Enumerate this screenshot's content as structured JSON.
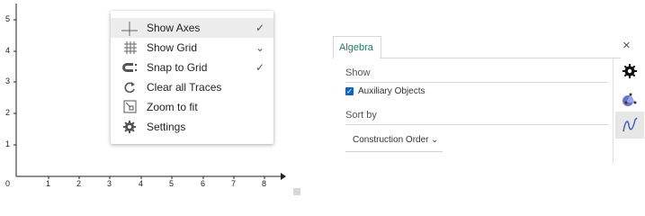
{
  "graphics": {
    "y_ticks": [
      "5",
      "4",
      "3",
      "2",
      "1"
    ],
    "x_ticks": [
      "0",
      "1",
      "2",
      "3",
      "4",
      "5",
      "6",
      "7",
      "8"
    ]
  },
  "context_menu": {
    "items": [
      {
        "label": "Show Axes",
        "icon": "axes-icon",
        "trail": "✓",
        "highlighted": true
      },
      {
        "label": "Show Grid",
        "icon": "grid-icon",
        "trail": "⌄",
        "highlighted": false
      },
      {
        "label": "Snap to Grid",
        "icon": "magnet-icon",
        "trail": "✓",
        "highlighted": false
      },
      {
        "label": "Clear all Traces",
        "icon": "refresh-icon",
        "trail": "",
        "highlighted": false
      },
      {
        "label": "Zoom to fit",
        "icon": "zoom-fit-icon",
        "trail": "",
        "highlighted": false
      },
      {
        "label": "Settings",
        "icon": "gear-icon",
        "trail": "",
        "highlighted": false
      }
    ]
  },
  "algebra": {
    "tab_label": "Algebra",
    "show_header": "Show",
    "auxiliary_label": "Auxiliary Objects",
    "auxiliary_checked": true,
    "sort_header": "Sort by",
    "sort_value": "Construction Order"
  },
  "sidebar": {
    "close_glyph": "×",
    "buttons": [
      "gear-icon",
      "graphics-style-icon",
      "algebra-style-icon"
    ]
  },
  "colors": {
    "accent": "#1b7a71",
    "checkbox": "#1565c0",
    "menu_highlight": "#ececec"
  }
}
